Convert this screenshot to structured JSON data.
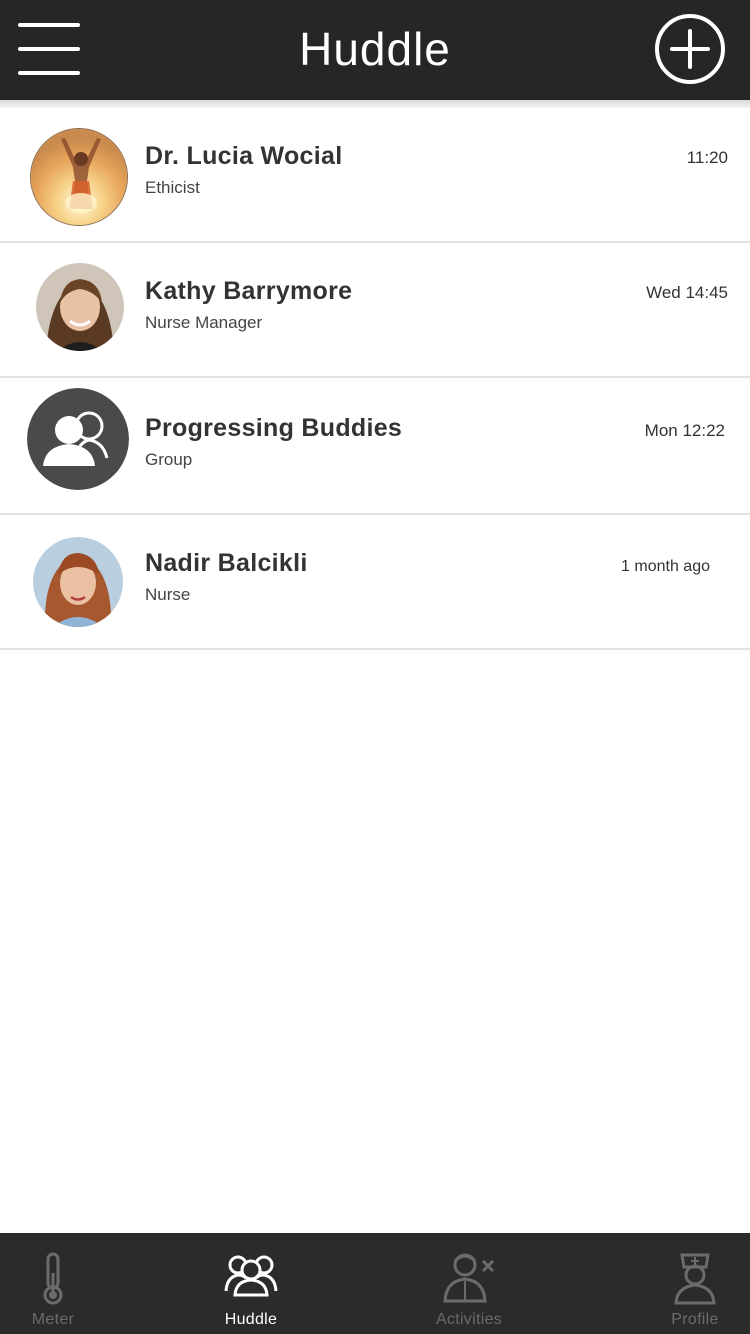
{
  "header": {
    "title": "Huddle",
    "menu_icon": "hamburger-menu-icon",
    "add_icon": "plus-circle-icon"
  },
  "conversations": [
    {
      "name": "Dr. Lucia Wocial",
      "role": "Ethicist",
      "time": "11:20",
      "avatar": "photo"
    },
    {
      "name": "Kathy Barrymore",
      "role": "Nurse Manager",
      "time": "Wed 14:45",
      "avatar": "photo"
    },
    {
      "name": "Progressing Buddies",
      "role": "Group",
      "time": "Mon 12:22",
      "avatar": "group-icon"
    },
    {
      "name": "Nadir Balcikli",
      "role": "Nurse",
      "time": "1 month ago",
      "avatar": "photo"
    }
  ],
  "tabbar": {
    "tabs": [
      {
        "label": "Meter",
        "icon": "thermometer-icon",
        "active": false
      },
      {
        "label": "Huddle",
        "icon": "group-icon",
        "active": true
      },
      {
        "label": "Activities",
        "icon": "doctor-icon",
        "active": false
      },
      {
        "label": "Profile",
        "icon": "nurse-icon",
        "active": false
      }
    ]
  },
  "colors": {
    "header_bg": "#262626",
    "tabbar_bg": "#2b2b2b",
    "active_tab": "#ffffff",
    "inactive_tab": "#6b6b6b",
    "divider": "#e3e3e3"
  }
}
